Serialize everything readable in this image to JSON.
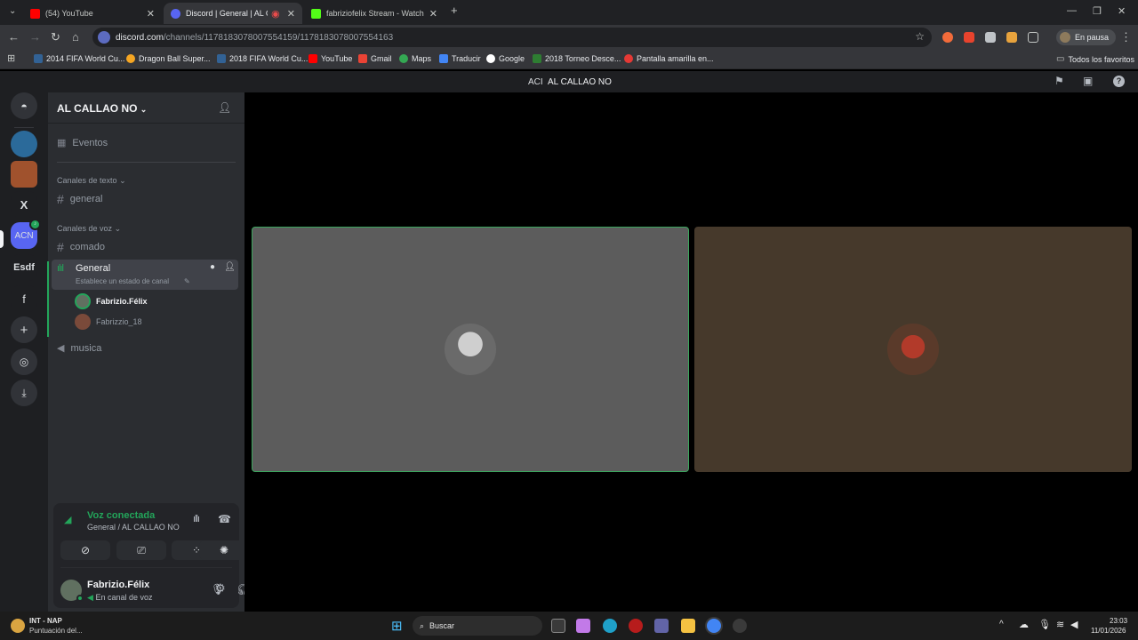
{
  "browser": {
    "tabs": [
      {
        "title": "(54) YouTube",
        "favicon_color": "#ff0000",
        "active": false
      },
      {
        "title": "Discord | General | AL CALL",
        "favicon_color": "#5865f2",
        "active": true
      },
      {
        "title": "fabriziofelix Stream - Watch Liv",
        "favicon_color": "#53fc18",
        "active": false
      }
    ],
    "url_host": "discord.com",
    "url_path": "/channels/1178183078007554159/1178183078007554163",
    "profile_label": "En pausa",
    "bookmarks": [
      {
        "label": "2014 FIFA World Cu...",
        "color": "#326295"
      },
      {
        "label": "Dragon Ball Super...",
        "color": "#f5a623"
      },
      {
        "label": "2018 FIFA World Cu...",
        "color": "#326295"
      },
      {
        "label": "YouTube",
        "color": "#ff0000"
      },
      {
        "label": "Gmail",
        "color": "#ea4335"
      },
      {
        "label": "Maps",
        "color": "#34a853"
      },
      {
        "label": "Traducir",
        "color": "#4285f4"
      },
      {
        "label": "Google",
        "color": "#ffffff"
      },
      {
        "label": "2018 Torneo Desce...",
        "color": "#2e7d32"
      },
      {
        "label": "Pantalla amarilla en...",
        "color": "#e53935"
      }
    ],
    "all_bookmarks": "Todos los favoritos"
  },
  "discord": {
    "titlebar": {
      "acronym": "ACI",
      "server": "AL CALLAO NO"
    },
    "guilds": [
      {
        "label": "",
        "color": "#2b6a9a"
      },
      {
        "label": "",
        "color": "#a0522d"
      },
      {
        "label": "X",
        "color": "#1e1f22"
      },
      {
        "label": "ACN",
        "color": "#5865f2"
      },
      {
        "label": "Esdf",
        "color": "#1e1f22"
      },
      {
        "label": "f",
        "color": "#1e1f22"
      }
    ],
    "server_name": "AL CALLAO NO",
    "events_label": "Eventos",
    "text_category": "Canales de texto",
    "text_channels": [
      "general"
    ],
    "voice_category": "Canales de voz",
    "voice_channels": {
      "comado": "comado",
      "general": "General",
      "general_status": "Establece un estado de canal",
      "musica": "musica"
    },
    "voice_users": [
      {
        "name": "Fabrizio.Félix",
        "avatar_color": "#607060"
      },
      {
        "name": "Fabrizzio_18",
        "avatar_color": "#7a4a3a"
      }
    ],
    "voice_panel": {
      "status": "Voz conectada",
      "location": "General / AL CALLAO NO"
    },
    "user": {
      "name": "Fabrizio.Félix",
      "status": "En canal de voz"
    },
    "stage_tiles": [
      {
        "bg": "#5c5c5c",
        "border": "#3ba55d",
        "avatar_color": "#8a8a8a"
      },
      {
        "bg": "#46392b",
        "border": "#46392b",
        "avatar_color": "#9a3a2a"
      }
    ]
  },
  "taskbar": {
    "weather_title": "INT - NAP",
    "weather_sub": "Puntuación del...",
    "search": "Buscar",
    "time": "23:03",
    "date": "11/01/2026"
  }
}
